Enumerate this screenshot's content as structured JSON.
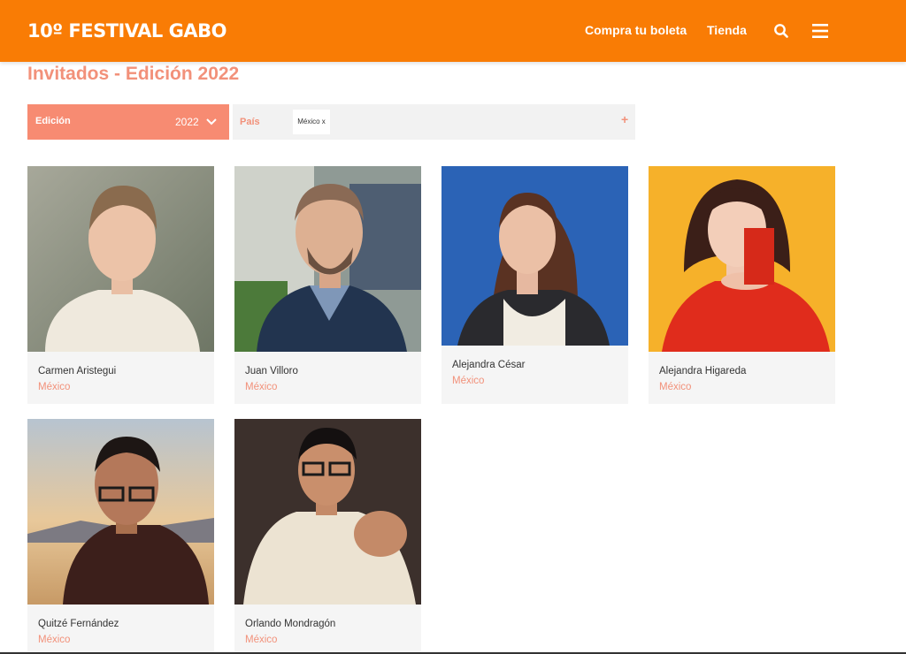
{
  "header": {
    "logo": "10º FESTIVAL GABO",
    "nav": {
      "buy_label": "Compra tu boleta",
      "shop_label": "Tienda"
    },
    "icons": {
      "search": "search-icon",
      "menu": "hamburger-menu-icon"
    },
    "colors": {
      "brand_orange": "#f97c05"
    }
  },
  "page": {
    "title": "Invitados - Edición 2022"
  },
  "filters": {
    "edition": {
      "label": "Edición",
      "value": "2022"
    },
    "country": {
      "label": "País",
      "chip": "México x"
    }
  },
  "guests": [
    {
      "name": "Carmen Aristegui",
      "country": "México"
    },
    {
      "name": "Juan Villoro",
      "country": "México"
    },
    {
      "name": "Alejandra César",
      "country": "México"
    },
    {
      "name": "Alejandra Higareda",
      "country": "México"
    },
    {
      "name": "Quitzé Fernández",
      "country": "México"
    },
    {
      "name": "Orlando Mondragón",
      "country": "México"
    }
  ],
  "colors": {
    "accent": "#f2917a",
    "filter_active": "#f78b72"
  }
}
